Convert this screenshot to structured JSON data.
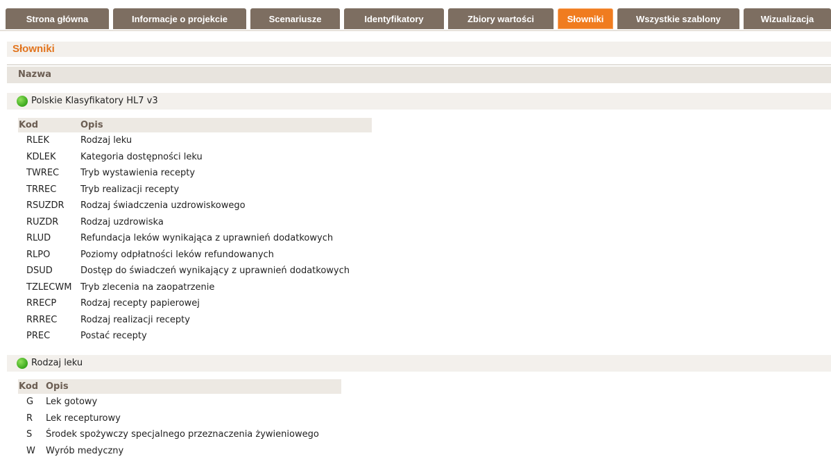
{
  "tabs": [
    {
      "label": "Strona główna",
      "active": false
    },
    {
      "label": "Informacje o projekcie",
      "active": false
    },
    {
      "label": "Scenariusze",
      "active": false
    },
    {
      "label": "Identyfikatory",
      "active": false
    },
    {
      "label": "Zbiory wartości",
      "active": false
    },
    {
      "label": "Słowniki",
      "active": true
    },
    {
      "label": "Wszystkie szablony",
      "active": false
    },
    {
      "label": "Wizualizacja",
      "active": false
    }
  ],
  "page": {
    "title": "Słowniki",
    "column_header": "Nazwa"
  },
  "colors": {
    "tab_bg": "#7d6e61",
    "tab_active_bg": "#f07c1f",
    "title_color": "#e2741d",
    "status_dot": "#3aa71d"
  },
  "groups": [
    {
      "name": "Polskie Klasyfikatory HL7 v3",
      "icon": "green-dot-icon",
      "headers": {
        "kod": "Kod",
        "opis": "Opis"
      },
      "rows": [
        {
          "kod": "RLEK",
          "opis": "Rodzaj leku"
        },
        {
          "kod": "KDLEK",
          "opis": "Kategoria dostępności leku"
        },
        {
          "kod": "TWREC",
          "opis": "Tryb wystawienia recepty"
        },
        {
          "kod": "TRREC",
          "opis": "Tryb realizacji recepty"
        },
        {
          "kod": "RSUZDR",
          "opis": "Rodzaj świadczenia uzdrowiskowego"
        },
        {
          "kod": "RUZDR",
          "opis": "Rodzaj uzdrowiska"
        },
        {
          "kod": "RLUD",
          "opis": "Refundacja leków wynikająca z uprawnień dodatkowych"
        },
        {
          "kod": "RLPO",
          "opis": "Poziomy odpłatności leków refundowanych"
        },
        {
          "kod": "DSUD",
          "opis": "Dostęp do świadczeń wynikający z uprawnień dodatkowych"
        },
        {
          "kod": "TZLECWM",
          "opis": "Tryb zlecenia na zaopatrzenie"
        },
        {
          "kod": "RRECP",
          "opis": "Rodzaj recepty papierowej"
        },
        {
          "kod": "RRREC",
          "opis": "Rodzaj realizacji recepty"
        },
        {
          "kod": "PREC",
          "opis": "Postać recepty"
        }
      ]
    },
    {
      "name": "Rodzaj leku",
      "icon": "green-dot-icon",
      "headers": {
        "kod": "Kod",
        "opis": "Opis"
      },
      "rows": [
        {
          "kod": "G",
          "opis": "Lek gotowy"
        },
        {
          "kod": "R",
          "opis": "Lek recepturowy"
        },
        {
          "kod": "S",
          "opis": "Środek spożywczy specjalnego przeznaczenia żywieniowego"
        },
        {
          "kod": "W",
          "opis": "Wyrób medyczny"
        }
      ]
    }
  ]
}
